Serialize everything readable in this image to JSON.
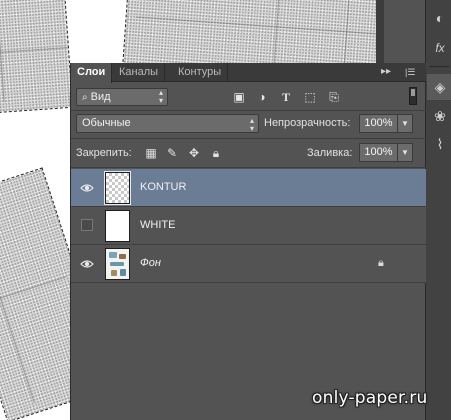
{
  "tabs": [
    {
      "label": "Слои",
      "active": true
    },
    {
      "label": "Каналы",
      "active": false
    },
    {
      "label": "Контуры",
      "active": false
    }
  ],
  "filter": {
    "kind_label": "Вид",
    "icons": [
      "image-filter-icon",
      "adjustment-filter-icon",
      "type-filter-icon",
      "shape-filter-icon",
      "smart-object-filter-icon"
    ]
  },
  "blend": {
    "mode": "Обычные",
    "opacity_label": "Непрозрачность:",
    "opacity_value": "100%"
  },
  "lock": {
    "label": "Закрепить:",
    "fill_label": "Заливка:",
    "fill_value": "100%"
  },
  "layers": [
    {
      "name": "KONTUR",
      "visible": true,
      "selected": true,
      "locked": false,
      "thumb": "transparent"
    },
    {
      "name": "WHITE",
      "visible": false,
      "selected": false,
      "locked": false,
      "thumb": "white"
    },
    {
      "name": "Фон",
      "visible": true,
      "selected": false,
      "locked": true,
      "thumb": "image"
    }
  ],
  "right_tools": [
    "color-palette-icon",
    "fx-styles-icon",
    "layers-panel-icon",
    "channels-icon",
    "paths-icon"
  ],
  "watermark": "only-paper.ru",
  "colors": {
    "panel_bg": "#535353",
    "selected_row": "#6b7c95",
    "tabbar_bg": "#3a3a3a"
  }
}
